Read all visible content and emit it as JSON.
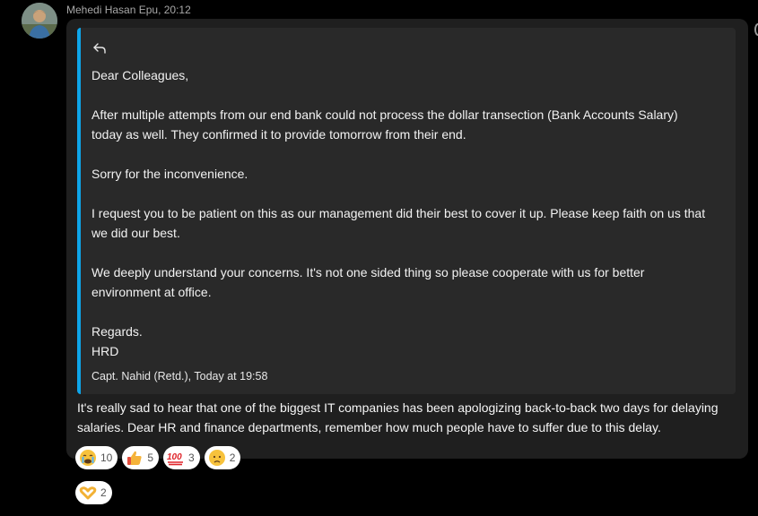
{
  "message": {
    "sender_name": "Mehedi Hasan Epu",
    "timestamp": "20:12",
    "avatar_icon": "user-avatar-photo"
  },
  "quote": {
    "accent_color": "#0ea5e9",
    "icon": "reply-arrow-icon",
    "paragraphs": [
      "Dear Colleagues,",
      "After multiple attempts from our end bank could not process the dollar transection (Bank Accounts Salary) today as well. They confirmed it to provide tomorrow from their end.",
      "Sorry for the inconvenience.",
      "I request you to be patient on this as our management did their best to cover it up. Please keep faith on us that we did our best.",
      "We deeply understand your concerns. It's not one sided thing so please cooperate with us for better environment at office.",
      "Regards.",
      "HRD"
    ],
    "meta": "Capt. Nahid (Retd.), Today at 19:58"
  },
  "reply_text": "It's really sad to hear that one of the biggest IT companies has been apologizing back-to-back two days for delaying salaries. Dear HR and finance departments, remember how much people have to suffer due to this delay.",
  "reactions": [
    {
      "icon": "crying-face-icon",
      "count": "10"
    },
    {
      "icon": "thumbs-up-icon",
      "count": "5"
    },
    {
      "icon": "hundred-points-icon",
      "count": "3"
    },
    {
      "icon": "sad-face-icon",
      "count": "2"
    },
    {
      "icon": "heart-hands-icon",
      "count": "2"
    }
  ]
}
